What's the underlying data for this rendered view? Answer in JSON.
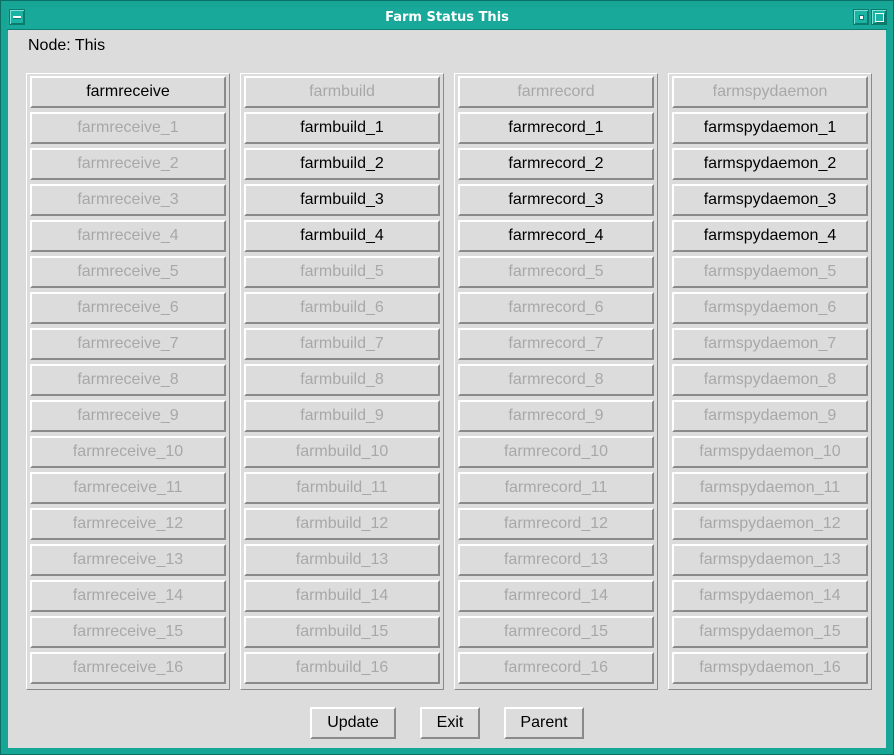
{
  "window": {
    "title": "Farm Status This"
  },
  "node_label": "Node: This",
  "columns": [
    {
      "buttons": [
        {
          "label": "farmreceive",
          "active": true
        },
        {
          "label": "farmreceive_1",
          "active": false
        },
        {
          "label": "farmreceive_2",
          "active": false
        },
        {
          "label": "farmreceive_3",
          "active": false
        },
        {
          "label": "farmreceive_4",
          "active": false
        },
        {
          "label": "farmreceive_5",
          "active": false
        },
        {
          "label": "farmreceive_6",
          "active": false
        },
        {
          "label": "farmreceive_7",
          "active": false
        },
        {
          "label": "farmreceive_8",
          "active": false
        },
        {
          "label": "farmreceive_9",
          "active": false
        },
        {
          "label": "farmreceive_10",
          "active": false
        },
        {
          "label": "farmreceive_11",
          "active": false
        },
        {
          "label": "farmreceive_12",
          "active": false
        },
        {
          "label": "farmreceive_13",
          "active": false
        },
        {
          "label": "farmreceive_14",
          "active": false
        },
        {
          "label": "farmreceive_15",
          "active": false
        },
        {
          "label": "farmreceive_16",
          "active": false
        }
      ]
    },
    {
      "buttons": [
        {
          "label": "farmbuild",
          "active": false
        },
        {
          "label": "farmbuild_1",
          "active": true
        },
        {
          "label": "farmbuild_2",
          "active": true
        },
        {
          "label": "farmbuild_3",
          "active": true
        },
        {
          "label": "farmbuild_4",
          "active": true
        },
        {
          "label": "farmbuild_5",
          "active": false
        },
        {
          "label": "farmbuild_6",
          "active": false
        },
        {
          "label": "farmbuild_7",
          "active": false
        },
        {
          "label": "farmbuild_8",
          "active": false
        },
        {
          "label": "farmbuild_9",
          "active": false
        },
        {
          "label": "farmbuild_10",
          "active": false
        },
        {
          "label": "farmbuild_11",
          "active": false
        },
        {
          "label": "farmbuild_12",
          "active": false
        },
        {
          "label": "farmbuild_13",
          "active": false
        },
        {
          "label": "farmbuild_14",
          "active": false
        },
        {
          "label": "farmbuild_15",
          "active": false
        },
        {
          "label": "farmbuild_16",
          "active": false
        }
      ]
    },
    {
      "buttons": [
        {
          "label": "farmrecord",
          "active": false
        },
        {
          "label": "farmrecord_1",
          "active": true
        },
        {
          "label": "farmrecord_2",
          "active": true
        },
        {
          "label": "farmrecord_3",
          "active": true
        },
        {
          "label": "farmrecord_4",
          "active": true
        },
        {
          "label": "farmrecord_5",
          "active": false
        },
        {
          "label": "farmrecord_6",
          "active": false
        },
        {
          "label": "farmrecord_7",
          "active": false
        },
        {
          "label": "farmrecord_8",
          "active": false
        },
        {
          "label": "farmrecord_9",
          "active": false
        },
        {
          "label": "farmrecord_10",
          "active": false
        },
        {
          "label": "farmrecord_11",
          "active": false
        },
        {
          "label": "farmrecord_12",
          "active": false
        },
        {
          "label": "farmrecord_13",
          "active": false
        },
        {
          "label": "farmrecord_14",
          "active": false
        },
        {
          "label": "farmrecord_15",
          "active": false
        },
        {
          "label": "farmrecord_16",
          "active": false
        }
      ]
    },
    {
      "buttons": [
        {
          "label": "farmspydaemon",
          "active": false
        },
        {
          "label": "farmspydaemon_1",
          "active": true
        },
        {
          "label": "farmspydaemon_2",
          "active": true
        },
        {
          "label": "farmspydaemon_3",
          "active": true
        },
        {
          "label": "farmspydaemon_4",
          "active": true
        },
        {
          "label": "farmspydaemon_5",
          "active": false
        },
        {
          "label": "farmspydaemon_6",
          "active": false
        },
        {
          "label": "farmspydaemon_7",
          "active": false
        },
        {
          "label": "farmspydaemon_8",
          "active": false
        },
        {
          "label": "farmspydaemon_9",
          "active": false
        },
        {
          "label": "farmspydaemon_10",
          "active": false
        },
        {
          "label": "farmspydaemon_11",
          "active": false
        },
        {
          "label": "farmspydaemon_12",
          "active": false
        },
        {
          "label": "farmspydaemon_13",
          "active": false
        },
        {
          "label": "farmspydaemon_14",
          "active": false
        },
        {
          "label": "farmspydaemon_15",
          "active": false
        },
        {
          "label": "farmspydaemon_16",
          "active": false
        }
      ]
    }
  ],
  "actions": {
    "update_label": "Update",
    "exit_label": "Exit",
    "parent_label": "Parent"
  },
  "colors": {
    "window_frame": "#17a596",
    "panel": "#dcdcdc",
    "active_text": "#000000",
    "inactive_text": "#a8a8a8"
  }
}
